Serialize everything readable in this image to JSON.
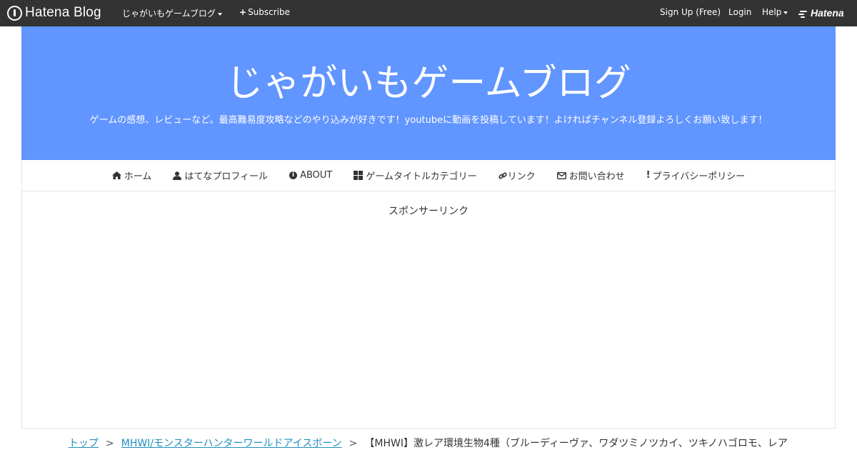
{
  "topbar": {
    "brand": "Hatena Blog",
    "blog_menu": "じゃがいもゲームブログ",
    "subscribe": "Subscribe",
    "signup": "Sign Up (Free)",
    "login": "Login",
    "help": "Help",
    "hatena": "Hatena"
  },
  "header": {
    "title": "じゃがいもゲームブログ",
    "description": "ゲームの感想、レビューなど。最高難易度攻略などのやり込みが好きです！youtubeに動画を投稿しています！よければチャンネル登録よろしくお願い致します！"
  },
  "nav": {
    "items": [
      {
        "label": "ホーム",
        "icon": "home-icon"
      },
      {
        "label": "はてなプロフィール",
        "icon": "user-icon"
      },
      {
        "label": "ABOUT",
        "icon": "info-icon"
      },
      {
        "label": "ゲームタイトルカテゴリー",
        "icon": "grid-icon"
      },
      {
        "label": "リンク",
        "icon": "link-icon"
      },
      {
        "label": "お問い合わせ",
        "icon": "envelope-icon"
      },
      {
        "label": "プライバシーポリシー",
        "icon": "exclamation-icon"
      }
    ]
  },
  "content": {
    "sponsor": "スポンサーリンク"
  },
  "breadcrumb": {
    "top": "トップ",
    "category": "MHWI/モンスターハンターワールドアイスボーン",
    "separator": ">",
    "current": "【MHWI】激レア環境生物4種（ブルーディーヴァ、ワダツミノツカイ、ツキノハゴロモ、レア"
  },
  "colors": {
    "topbar_bg": "#333333",
    "header_bg": "#6195ff",
    "link": "#1f8fbf"
  }
}
